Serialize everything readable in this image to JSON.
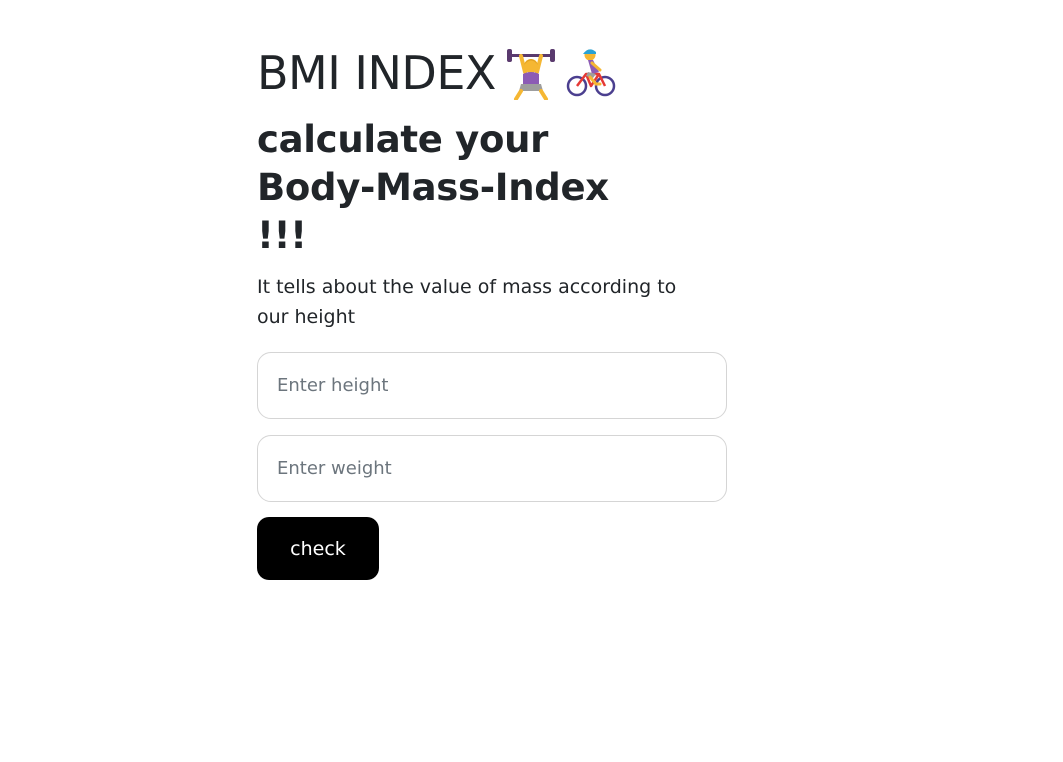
{
  "header": {
    "title": "BMI INDEX",
    "icons": [
      "weightlifter-icon",
      "cyclist-icon"
    ],
    "subtitle": "calculate your Body-Mass-Index !!!",
    "description": "It tells about the value of mass according to our height"
  },
  "form": {
    "height_placeholder": "Enter height",
    "height_value": "",
    "weight_placeholder": "Enter weight",
    "weight_value": "",
    "check_label": "check"
  },
  "colors": {
    "button_bg": "#000000",
    "button_text": "#ffffff",
    "text": "#212529",
    "input_border": "#d5d5d5"
  }
}
